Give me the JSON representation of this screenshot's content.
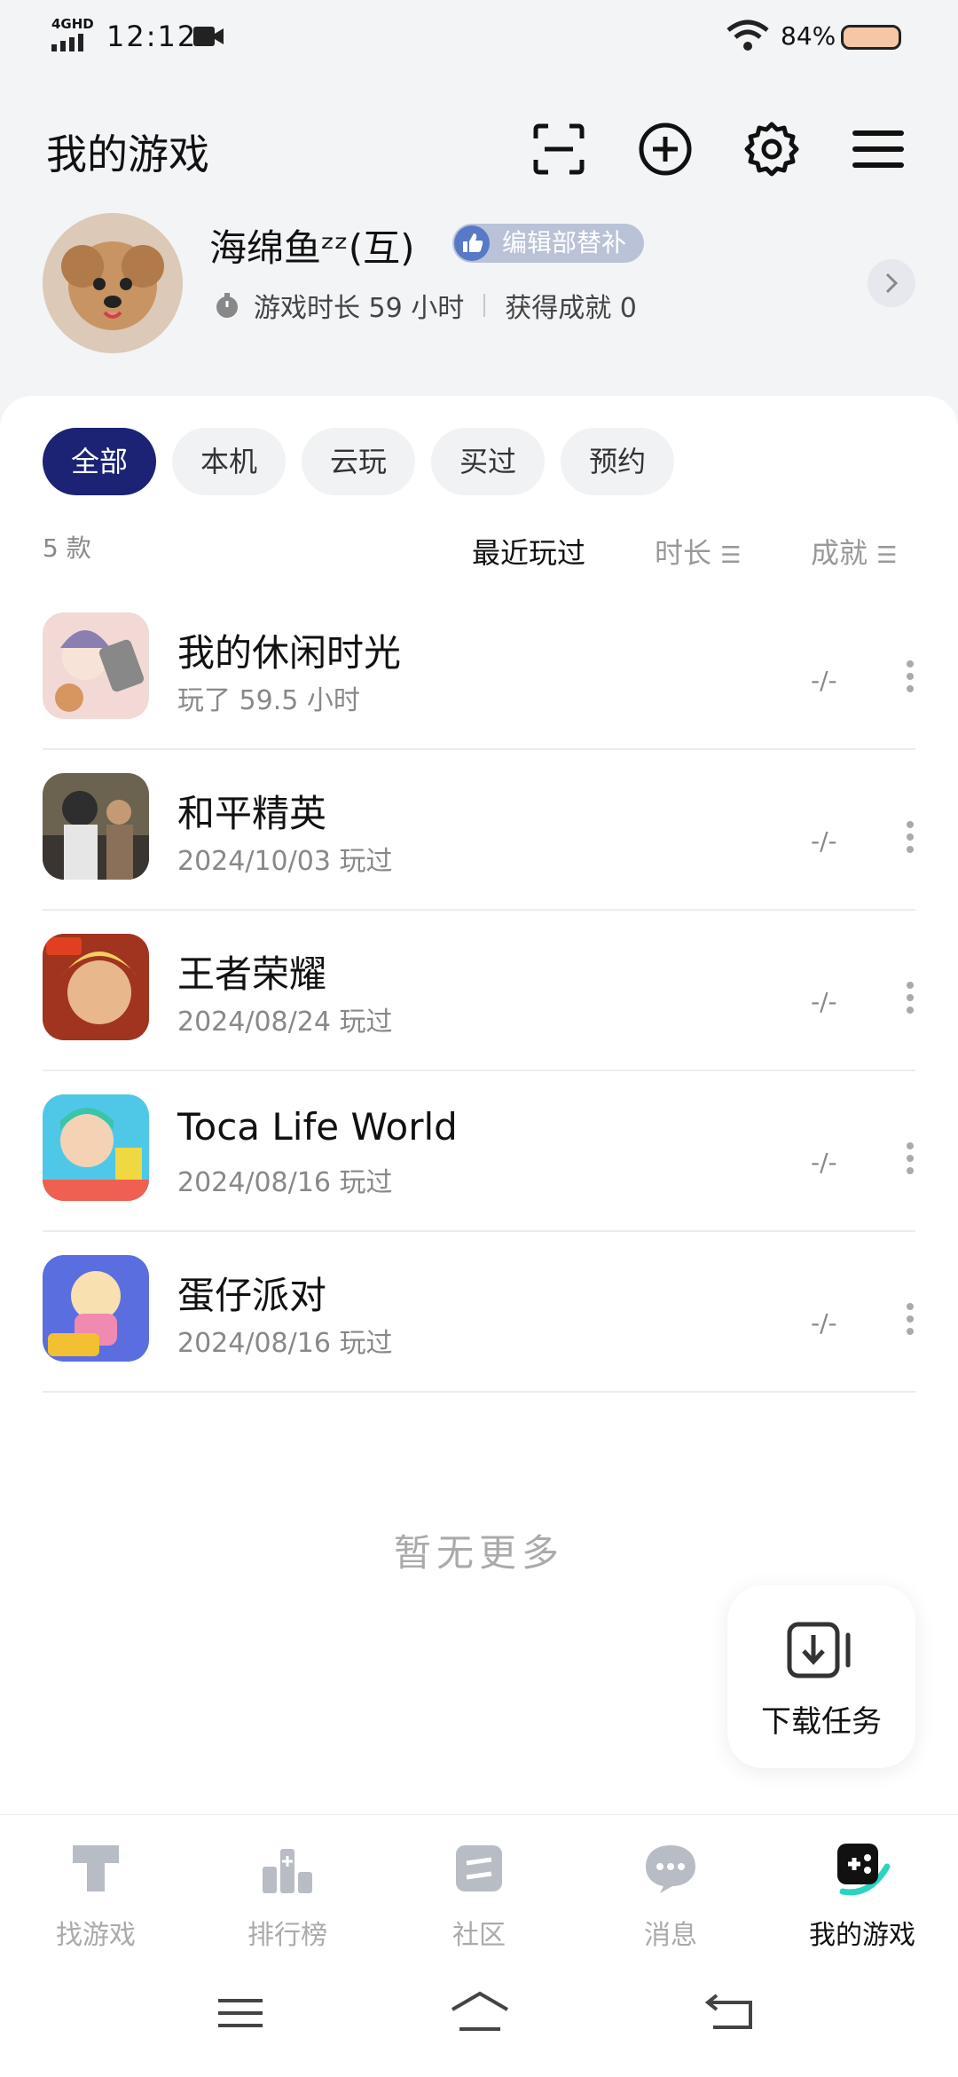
{
  "status_bar": {
    "network": "4GHD",
    "time": "12:12",
    "battery": "84%"
  },
  "header": {
    "title": "我的游戏",
    "icons": [
      "scan-icon",
      "add-circle-icon",
      "gear-icon",
      "menu-icon"
    ]
  },
  "profile": {
    "name": "海绵鱼ᶻᶻ(互)",
    "badge": "编辑部替补",
    "playtime": "游戏时长 59 小时",
    "achievements": "获得成就 0"
  },
  "filters": {
    "chips": [
      "全部",
      "本机",
      "云玩",
      "买过",
      "预约"
    ],
    "active_index": 0
  },
  "list": {
    "count": "5 款",
    "sorts": [
      "最近玩过",
      "时长",
      "成就"
    ],
    "active_sort": "最近玩过",
    "games": [
      {
        "name": "我的休闲时光",
        "sub": "玩了 59.5 小时",
        "achievement": "-/-"
      },
      {
        "name": "和平精英",
        "sub": "2024/10/03 玩过",
        "achievement": "-/-"
      },
      {
        "name": "王者荣耀",
        "sub": "2024/08/24 玩过",
        "achievement": "-/-"
      },
      {
        "name": "Toca Life World",
        "sub": "2024/08/16 玩过",
        "achievement": "-/-"
      },
      {
        "name": "蛋仔派对",
        "sub": "2024/08/16 玩过",
        "achievement": "-/-"
      }
    ],
    "empty_text": "暂无更多"
  },
  "download": {
    "label": "下载任务"
  },
  "bottom_nav": {
    "items": [
      "找游戏",
      "排行榜",
      "社区",
      "消息",
      "我的游戏"
    ],
    "active": "我的游戏"
  },
  "colors": {
    "accent": "#1c2374",
    "background": "#f3f4f6",
    "badge": "#b9c2d6"
  }
}
